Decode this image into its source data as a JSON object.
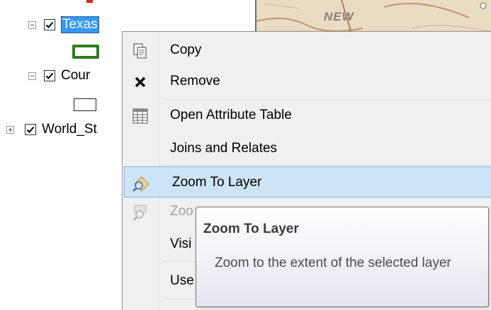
{
  "toc": {
    "layers": [
      {
        "name": "Texas",
        "checked": true,
        "expanded": true,
        "selected": true
      },
      {
        "name": "Cour",
        "checked": true,
        "expanded": true,
        "selected": false
      },
      {
        "name": "World_St",
        "checked": true,
        "expanded": false,
        "selected": false
      }
    ]
  },
  "map": {
    "label": "NEW"
  },
  "context_menu": {
    "items": [
      {
        "label": "Copy",
        "icon": "copy-icon"
      },
      {
        "label": "Remove",
        "icon": "remove-x-icon"
      },
      {
        "label": "Open Attribute Table",
        "icon": "attribute-table-icon"
      },
      {
        "label": "Joins and Relates",
        "icon": ""
      },
      {
        "label": "Zoom To Layer",
        "icon": "zoom-to-layer-icon",
        "highlighted": true
      },
      {
        "label": "Zoo",
        "icon": "zoom-to-visible-scale-icon",
        "disabled": true
      },
      {
        "label": "Visi",
        "icon": ""
      },
      {
        "label": "Use",
        "icon": ""
      }
    ]
  },
  "tooltip": {
    "title": "Zoom To Layer",
    "description": "Zoom to the extent of the selected layer"
  },
  "colors": {
    "selection": "#3399ff",
    "menu_hover": "#cde4f7",
    "swatch_green": "#2d7d1c"
  }
}
